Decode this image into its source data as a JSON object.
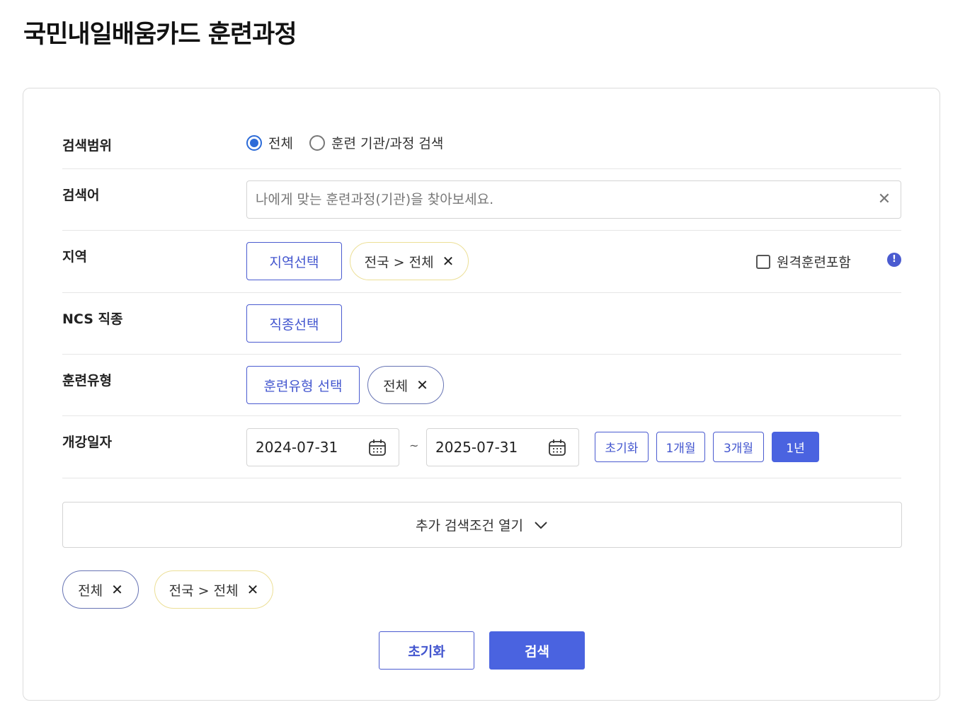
{
  "page": {
    "title": "국민내일배움카드 훈련과정"
  },
  "scope": {
    "label": "검색범위",
    "options": [
      {
        "label": "전체",
        "checked": true
      },
      {
        "label": "훈련 기관/과정 검색",
        "checked": false
      }
    ]
  },
  "keyword": {
    "label": "검색어",
    "placeholder": "나에게 맞는 훈련과정(기관)을 찾아보세요.",
    "value": ""
  },
  "region": {
    "label": "지역",
    "select_button": "지역선택",
    "chip": "전국 > 전체",
    "remote_checkbox": "원격훈련포함",
    "remote_checked": false
  },
  "ncs": {
    "label": "NCS 직종",
    "select_button": "직종선택"
  },
  "training_type": {
    "label": "훈련유형",
    "select_button": "훈련유형 선택",
    "chip": "전체"
  },
  "start_date": {
    "label": "개강일자",
    "from": "2024-07-31",
    "separator": "~",
    "to": "2025-07-31",
    "quick_buttons": [
      {
        "label": "초기화",
        "active": false
      },
      {
        "label": "1개월",
        "active": false
      },
      {
        "label": "3개월",
        "active": false
      },
      {
        "label": "1년",
        "active": true
      }
    ]
  },
  "more_filters": {
    "label": "추가 검색조건 열기"
  },
  "selected_chips": [
    {
      "label": "전체"
    },
    {
      "label": "전국 > 전체"
    }
  ],
  "actions": {
    "reset": "초기화",
    "search": "검색"
  },
  "colors": {
    "accent": "#4a63e0",
    "radio_checked": "#2c6bd8",
    "chip_yellow_border": "#ecdf96",
    "chip_blue_border": "#6774b4"
  }
}
